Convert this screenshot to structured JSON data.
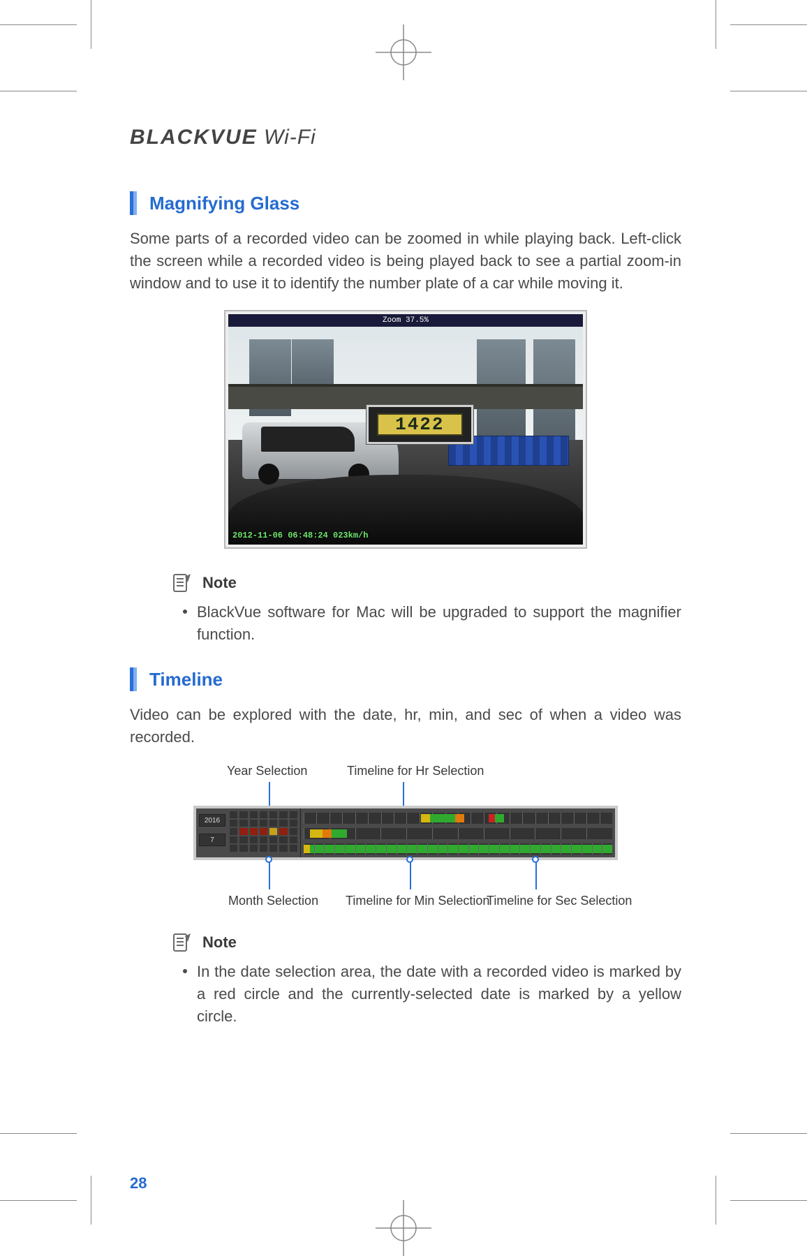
{
  "brand": {
    "name_strong": "BLACKVUE",
    "name_light": "Wi-Fi"
  },
  "sections": {
    "magnify": {
      "heading": "Magnifying Glass",
      "para": "Some parts of a recorded video can be zoomed in while playing back. Left-click the screen while a recorded video is being played back to see a partial zoom-in window and to use it to identify the number plate of a car while moving it.",
      "zoom_title": "Zoom 37.5%",
      "plate": "1422",
      "timestamp": "2012-11-06 06:48:24  023km/h",
      "note_label": "Note",
      "note_item": "BlackVue software for Mac will be upgraded to support the magnifier function."
    },
    "timeline": {
      "heading": "Timeline",
      "para": "Video can be explored with the date, hr, min, and sec of when a video was recorded.",
      "year": "2016",
      "month": "7",
      "labels": {
        "year": "Year Selection",
        "month": "Month Selection",
        "hr": "Timeline for Hr Selection",
        "min": "Timeline for Min Selection",
        "sec": "Timeline for Sec Selection"
      },
      "note_label": "Note",
      "note_item": "In the date selection area, the date with a recorded video is marked by a red circle and the currently-selected date is marked by a yellow circle."
    }
  },
  "page_number": "28"
}
